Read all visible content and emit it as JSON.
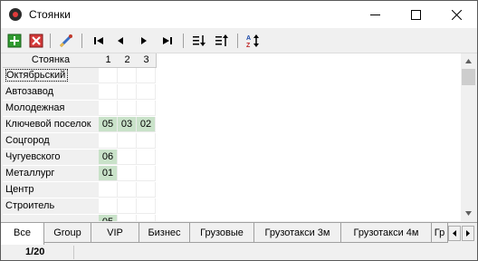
{
  "window": {
    "title": "Стоянки"
  },
  "toolbar": {
    "buttons": [
      {
        "name": "add-icon"
      },
      {
        "name": "delete-icon"
      },
      {
        "name": "edit-icon"
      },
      {
        "name": "first-record-icon"
      },
      {
        "name": "prev-record-icon"
      },
      {
        "name": "next-record-icon"
      },
      {
        "name": "last-record-icon"
      },
      {
        "name": "sort-down-icon"
      },
      {
        "name": "sort-up-icon"
      },
      {
        "name": "sort-alpha-icon"
      }
    ]
  },
  "grid": {
    "header_label": "Стоянка",
    "columns": [
      "1",
      "2",
      "3"
    ],
    "rows": [
      {
        "label": "Октябрьский",
        "cells": [
          "",
          "",
          ""
        ],
        "selected": true
      },
      {
        "label": "Автозавод",
        "cells": [
          "",
          "",
          ""
        ]
      },
      {
        "label": "Молодежная",
        "cells": [
          "",
          "",
          ""
        ]
      },
      {
        "label": "Ключевой поселок",
        "cells": [
          "05",
          "03",
          "02"
        ]
      },
      {
        "label": "Соцгород",
        "cells": [
          "",
          "",
          ""
        ]
      },
      {
        "label": "Чугуевского",
        "cells": [
          "06",
          "",
          ""
        ]
      },
      {
        "label": "Металлург",
        "cells": [
          "01",
          "",
          ""
        ]
      },
      {
        "label": "Центр",
        "cells": [
          "",
          "",
          ""
        ]
      },
      {
        "label": "Строитель",
        "cells": [
          "",
          "",
          ""
        ]
      },
      {
        "label": "",
        "cells": [
          "05",
          "",
          ""
        ]
      }
    ],
    "fill_color": "#c9e2c9"
  },
  "tabs": [
    "Все",
    "Group",
    "VIP",
    "Бизнес",
    "Грузовые",
    "Грузотакси 3м",
    "Грузотакси 4м",
    "Гр"
  ],
  "status": {
    "record": "1/20"
  }
}
